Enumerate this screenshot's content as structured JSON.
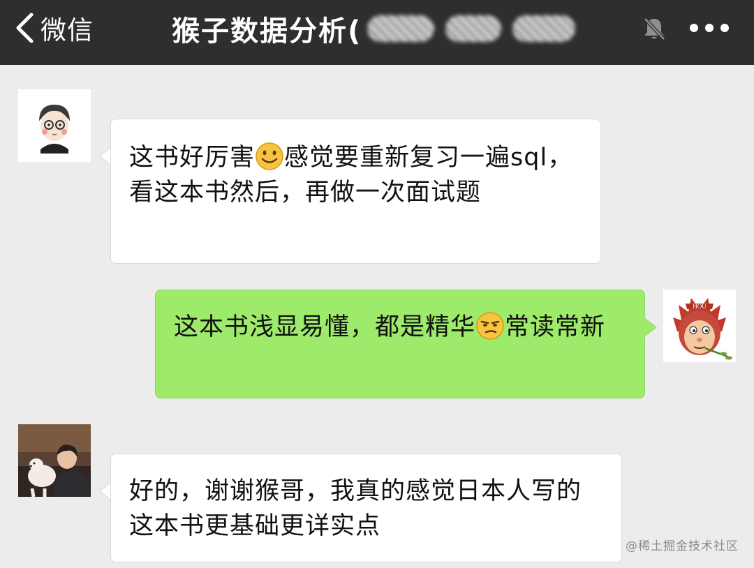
{
  "header": {
    "back_label": "微信",
    "title": "猴子数据分析(",
    "icons": {
      "back": "chevron-left-icon",
      "mute": "bell-muted-icon",
      "more": "more-dots-icon"
    }
  },
  "messages": [
    {
      "side": "left",
      "avatar": "avatar-cartoon-boy",
      "text_before": "这书好厉害",
      "emoji": "smile-emoji",
      "text_after": "感觉要重新复习一遍sql，看这本书然后，再做一次面试题"
    },
    {
      "side": "right",
      "avatar": "avatar-monkey-king",
      "text_before": "这本书浅显易懂，都是精华",
      "emoji": "smirk-emoji",
      "text_after": "常读常新"
    },
    {
      "side": "left",
      "avatar": "avatar-photo-with-dog",
      "text": "好的，谢谢猴哥，我真的感觉日本人写的这本书更基础更详实点"
    }
  ],
  "watermark": "@稀土掘金技术社区",
  "colors": {
    "topbar": "#2e2e2e",
    "background": "#ececec",
    "bubble_right": "#9eea6a",
    "bubble_left": "#ffffff"
  }
}
